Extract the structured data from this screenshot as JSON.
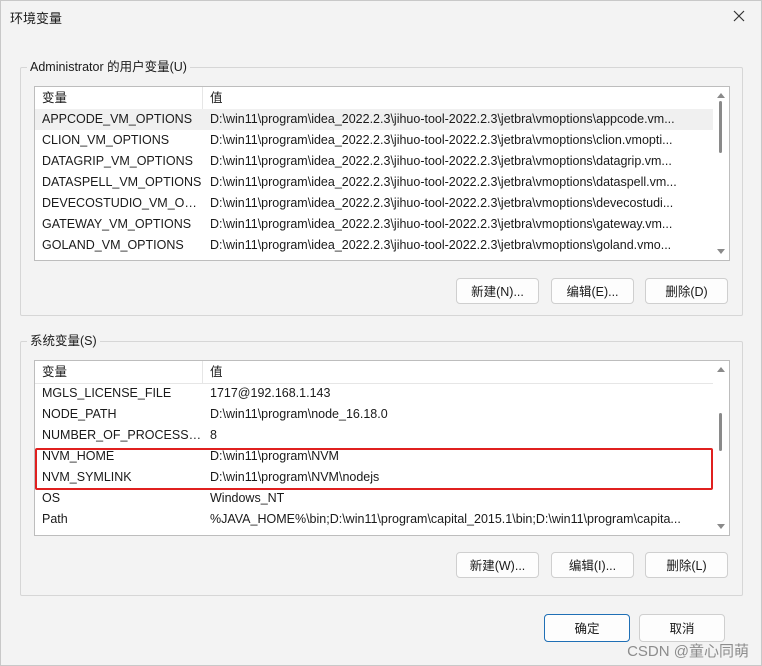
{
  "window": {
    "title": "环境变量",
    "close_icon": "close-icon"
  },
  "user_vars": {
    "group_label": "Administrator 的用户变量(U)",
    "col_name": "变量",
    "col_value": "值",
    "rows": [
      {
        "name": "APPCODE_VM_OPTIONS",
        "value": "D:\\win11\\program\\idea_2022.2.3\\jihuo-tool-2022.2.3\\jetbra\\vmoptions\\appcode.vm..."
      },
      {
        "name": "CLION_VM_OPTIONS",
        "value": "D:\\win11\\program\\idea_2022.2.3\\jihuo-tool-2022.2.3\\jetbra\\vmoptions\\clion.vmopti..."
      },
      {
        "name": "DATAGRIP_VM_OPTIONS",
        "value": "D:\\win11\\program\\idea_2022.2.3\\jihuo-tool-2022.2.3\\jetbra\\vmoptions\\datagrip.vm..."
      },
      {
        "name": "DATASPELL_VM_OPTIONS",
        "value": "D:\\win11\\program\\idea_2022.2.3\\jihuo-tool-2022.2.3\\jetbra\\vmoptions\\dataspell.vm..."
      },
      {
        "name": "DEVECOSTUDIO_VM_OPT...",
        "value": "D:\\win11\\program\\idea_2022.2.3\\jihuo-tool-2022.2.3\\jetbra\\vmoptions\\devecostudi..."
      },
      {
        "name": "GATEWAY_VM_OPTIONS",
        "value": "D:\\win11\\program\\idea_2022.2.3\\jihuo-tool-2022.2.3\\jetbra\\vmoptions\\gateway.vm..."
      },
      {
        "name": "GOLAND_VM_OPTIONS",
        "value": "D:\\win11\\program\\idea_2022.2.3\\jihuo-tool-2022.2.3\\jetbra\\vmoptions\\goland.vmo..."
      }
    ],
    "new_label": "新建(N)...",
    "edit_label": "编辑(E)...",
    "delete_label": "删除(D)"
  },
  "system_vars": {
    "group_label": "系统变量(S)",
    "col_name": "变量",
    "col_value": "值",
    "rows": [
      {
        "name": "MGLS_LICENSE_FILE",
        "value": "1717@192.168.1.143"
      },
      {
        "name": "NODE_PATH",
        "value": "D:\\win11\\program\\node_16.18.0"
      },
      {
        "name": "NUMBER_OF_PROCESSORS",
        "value": "8"
      },
      {
        "name": "NVM_HOME",
        "value": "D:\\win11\\program\\NVM"
      },
      {
        "name": "NVM_SYMLINK",
        "value": "D:\\win11\\program\\NVM\\nodejs"
      },
      {
        "name": "OS",
        "value": "Windows_NT"
      },
      {
        "name": "Path",
        "value": "%JAVA_HOME%\\bin;D:\\win11\\program\\capital_2015.1\\bin;D:\\win11\\program\\capita..."
      }
    ],
    "new_label": "新建(W)...",
    "edit_label": "编辑(I)...",
    "delete_label": "删除(L)"
  },
  "footer": {
    "ok_label": "确定",
    "cancel_label": "取消"
  },
  "watermark": "CSDN @童心同萌",
  "colors": {
    "highlight_box": "#e0201f",
    "primary_border": "#1f6fb5"
  }
}
